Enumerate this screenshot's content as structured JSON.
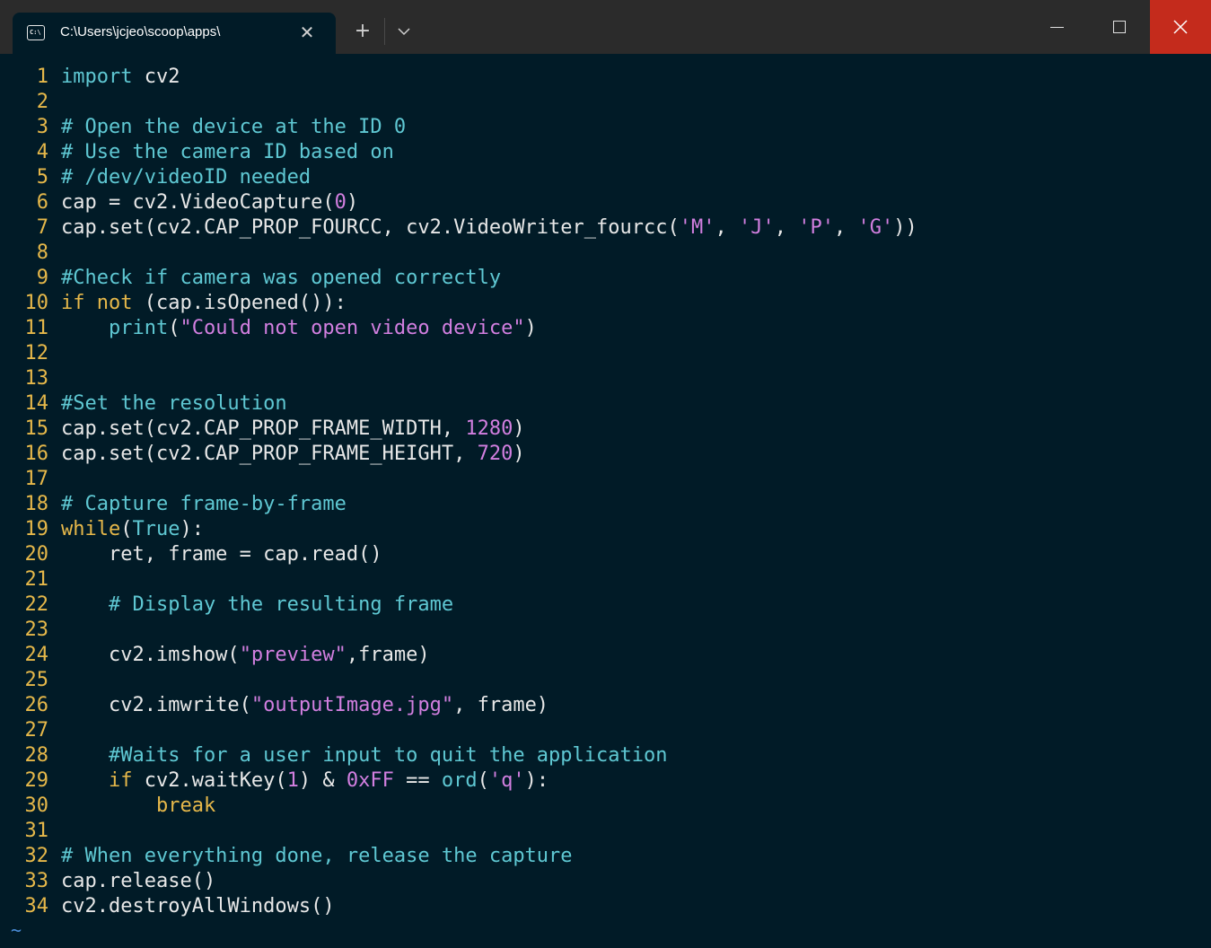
{
  "window": {
    "tab_title": "C:\\Users\\jcjeo\\scoop\\apps\\",
    "tab_icon": "command-prompt-icon",
    "close_tab_glyph": "✕",
    "new_tab_glyph": "+",
    "close_color": "#c42b1c"
  },
  "editor": {
    "colors": {
      "background": "#011b27",
      "line_number": "#e6b84a",
      "keyword": "#5fc8d3",
      "comment": "#5fc8d3",
      "string": "#d27fe0",
      "text": "#e8e8e8"
    },
    "lines": [
      {
        "n": "1",
        "tokens": [
          {
            "t": "import",
            "c": "kw"
          },
          {
            "t": " cv2"
          }
        ]
      },
      {
        "n": "2",
        "tokens": []
      },
      {
        "n": "3",
        "tokens": [
          {
            "t": "# Open the device at the ID 0",
            "c": "cm"
          }
        ]
      },
      {
        "n": "4",
        "tokens": [
          {
            "t": "# Use the camera ID based on",
            "c": "cm"
          }
        ]
      },
      {
        "n": "5",
        "tokens": [
          {
            "t": "# /dev/videoID needed",
            "c": "cm"
          }
        ]
      },
      {
        "n": "6",
        "tokens": [
          {
            "t": "cap = cv2.VideoCapture("
          },
          {
            "t": "0",
            "c": "num"
          },
          {
            "t": ")"
          }
        ]
      },
      {
        "n": "7",
        "tokens": [
          {
            "t": "cap.set(cv2.CAP_PROP_FOURCC, cv2.VideoWriter_fourcc("
          },
          {
            "t": "'M'",
            "c": "str"
          },
          {
            "t": ", "
          },
          {
            "t": "'J'",
            "c": "str"
          },
          {
            "t": ", "
          },
          {
            "t": "'P'",
            "c": "str"
          },
          {
            "t": ", "
          },
          {
            "t": "'G'",
            "c": "str"
          },
          {
            "t": "))"
          }
        ]
      },
      {
        "n": "8",
        "tokens": []
      },
      {
        "n": "9",
        "tokens": [
          {
            "t": "#Check if camera was opened correctly",
            "c": "cm"
          }
        ]
      },
      {
        "n": "10",
        "tokens": [
          {
            "t": "if",
            "c": "ctl"
          },
          {
            "t": " "
          },
          {
            "t": "not",
            "c": "ctl"
          },
          {
            "t": " (cap.isOpened()):"
          }
        ]
      },
      {
        "n": "11",
        "tokens": [
          {
            "t": "    "
          },
          {
            "t": "print",
            "c": "kw"
          },
          {
            "t": "("
          },
          {
            "t": "\"Could not open video device\"",
            "c": "str"
          },
          {
            "t": ")"
          }
        ]
      },
      {
        "n": "12",
        "tokens": []
      },
      {
        "n": "13",
        "tokens": []
      },
      {
        "n": "14",
        "tokens": [
          {
            "t": "#Set the resolution",
            "c": "cm"
          }
        ]
      },
      {
        "n": "15",
        "tokens": [
          {
            "t": "cap.set(cv2.CAP_PROP_FRAME_WIDTH, "
          },
          {
            "t": "1280",
            "c": "num"
          },
          {
            "t": ")"
          }
        ]
      },
      {
        "n": "16",
        "tokens": [
          {
            "t": "cap.set(cv2.CAP_PROP_FRAME_HEIGHT, "
          },
          {
            "t": "720",
            "c": "num"
          },
          {
            "t": ")"
          }
        ]
      },
      {
        "n": "17",
        "tokens": []
      },
      {
        "n": "18",
        "tokens": [
          {
            "t": "# Capture frame-by-frame",
            "c": "cm"
          }
        ]
      },
      {
        "n": "19",
        "tokens": [
          {
            "t": "while",
            "c": "ctl"
          },
          {
            "t": "("
          },
          {
            "t": "True",
            "c": "kw"
          },
          {
            "t": "):"
          }
        ]
      },
      {
        "n": "20",
        "tokens": [
          {
            "t": "    ret, frame = cap.read()"
          }
        ]
      },
      {
        "n": "21",
        "tokens": []
      },
      {
        "n": "22",
        "tokens": [
          {
            "t": "    "
          },
          {
            "t": "# Display the resulting frame",
            "c": "cm"
          }
        ]
      },
      {
        "n": "23",
        "tokens": []
      },
      {
        "n": "24",
        "tokens": [
          {
            "t": "    cv2.imshow("
          },
          {
            "t": "\"preview\"",
            "c": "str"
          },
          {
            "t": ",frame)"
          }
        ]
      },
      {
        "n": "25",
        "tokens": []
      },
      {
        "n": "26",
        "tokens": [
          {
            "t": "    cv2.imwrite("
          },
          {
            "t": "\"outputImage.jpg\"",
            "c": "str"
          },
          {
            "t": ", frame)"
          }
        ]
      },
      {
        "n": "27",
        "tokens": []
      },
      {
        "n": "28",
        "tokens": [
          {
            "t": "    "
          },
          {
            "t": "#Waits for a user input to quit the application",
            "c": "cm"
          }
        ]
      },
      {
        "n": "29",
        "tokens": [
          {
            "t": "    "
          },
          {
            "t": "if",
            "c": "ctl"
          },
          {
            "t": " cv2.waitKey("
          },
          {
            "t": "1",
            "c": "num"
          },
          {
            "t": ") & "
          },
          {
            "t": "0xFF",
            "c": "num"
          },
          {
            "t": " == "
          },
          {
            "t": "ord",
            "c": "kw"
          },
          {
            "t": "("
          },
          {
            "t": "'q'",
            "c": "str"
          },
          {
            "t": "):"
          }
        ]
      },
      {
        "n": "30",
        "tokens": [
          {
            "t": "        "
          },
          {
            "t": "break",
            "c": "ctl"
          }
        ]
      },
      {
        "n": "31",
        "tokens": []
      },
      {
        "n": "32",
        "tokens": [
          {
            "t": "# When everything done, release the capture",
            "c": "cm"
          }
        ]
      },
      {
        "n": "33",
        "tokens": [
          {
            "t": "cap.release()"
          }
        ]
      },
      {
        "n": "34",
        "tokens": [
          {
            "t": "cv2.destroyAllWindows()"
          }
        ]
      }
    ],
    "tilde": "~"
  }
}
